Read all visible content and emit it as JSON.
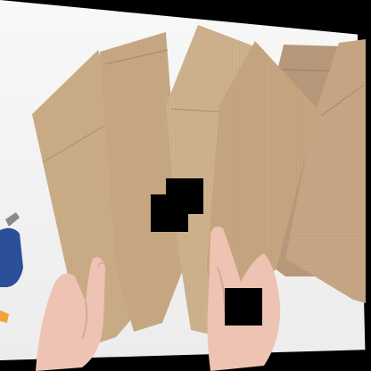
{
  "image": {
    "description_icons": [
      "cardboard-pieces",
      "hands",
      "hot-glue-gun"
    ],
    "colors": {
      "background": "#f4f4f4",
      "cardboard_light": "#c9ab86",
      "cardboard_mid": "#b89774",
      "cardboard_dark": "#a58766",
      "cardboard_back": "#b8987a",
      "skin": "#eec3b3",
      "skin_shadow": "#d9a797",
      "glue_gun_blue": "#2c4f9a",
      "glue_gun_orange": "#f3a13b",
      "redaction": "#000000"
    }
  }
}
